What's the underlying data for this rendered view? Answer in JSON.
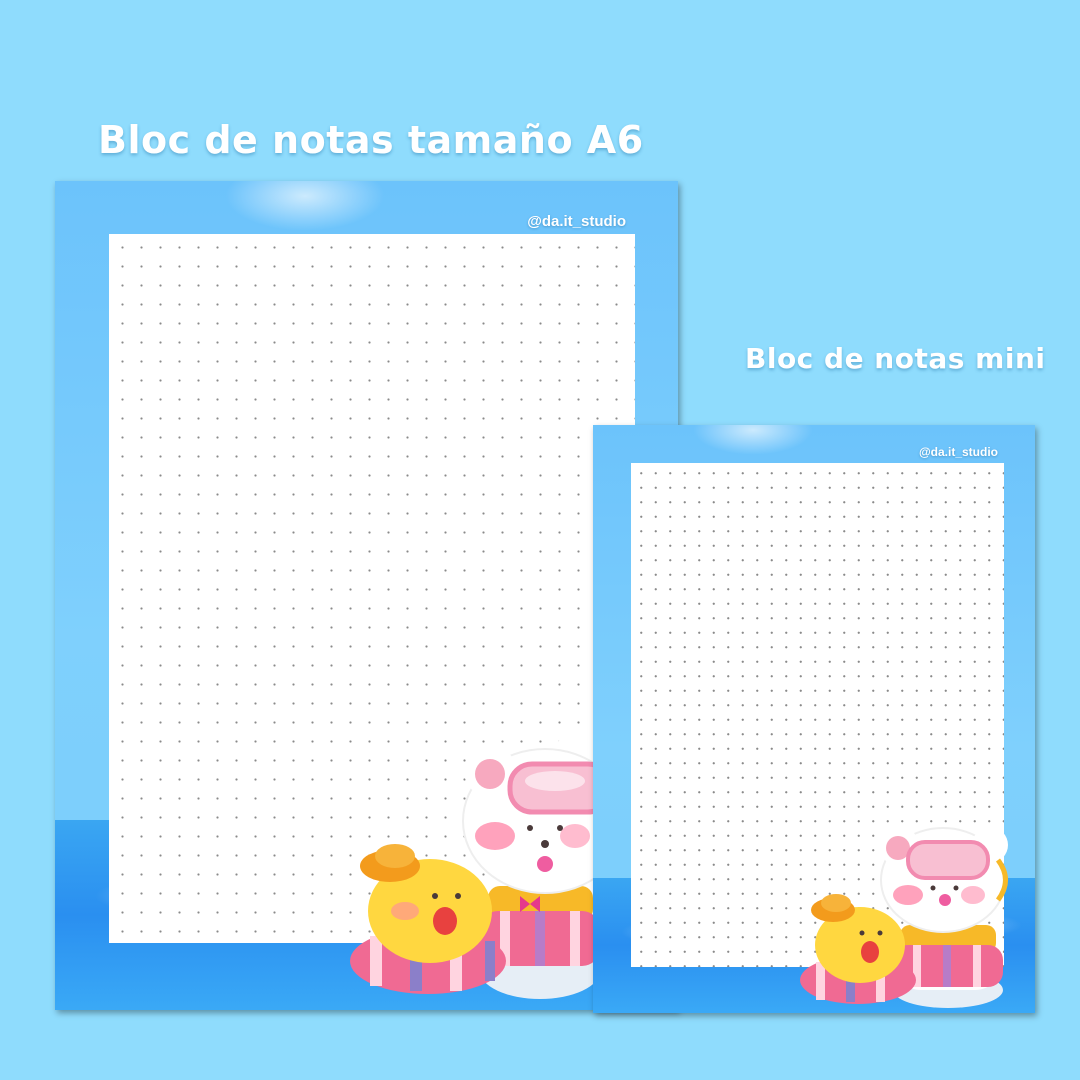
{
  "titles": {
    "a6": "Bloc de notas tamaño A6",
    "mini": "Bloc de notas mini"
  },
  "pads": {
    "a6": {
      "handle": "@da.it_studio"
    },
    "mini": {
      "handle": "@da.it_studio"
    }
  },
  "colors": {
    "background": "#8fdcfd",
    "pad_frame": "#6cc3fb",
    "water": "#2a8ff0",
    "sheet": "#ffffff"
  },
  "icons": [
    "bear-with-snorkel-icon",
    "duck-with-hat-icon",
    "swim-ring-icon"
  ]
}
